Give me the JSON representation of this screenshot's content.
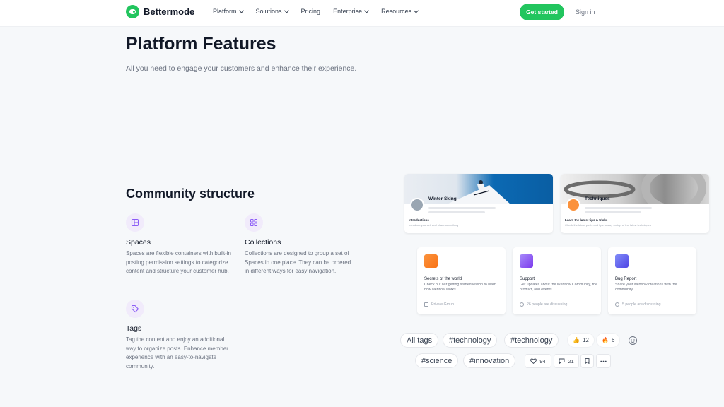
{
  "brand": {
    "name": "Bettermode",
    "accent": "#22c55e"
  },
  "nav": {
    "links": [
      "Platform",
      "Solutions",
      "Pricing",
      "Enterprise",
      "Resources"
    ],
    "cta": "Get started",
    "signin": "Sign in"
  },
  "hero": {
    "title": "Platform Features",
    "subtitle": "All you need to engage your customers and enhance their experience."
  },
  "community": {
    "title": "Community structure",
    "features": [
      {
        "title": "Spaces",
        "desc": "Spaces are flexible containers with built-in posting permission settings to categorize content and structure your customer hub.",
        "icon": "spaces-icon"
      },
      {
        "title": "Collections",
        "desc": "Collections are designed to group a set of Spaces in one place. They can be ordered in different ways for easy navigation.",
        "icon": "collections-icon"
      },
      {
        "title": "Tags",
        "desc": "Tag the content and enjoy an additional way to organize posts. Enhance member experience with an easy-to-navigate community.",
        "icon": "tag-icon"
      }
    ]
  },
  "spaces": [
    {
      "name": "Winter Sking",
      "section": "Introductions",
      "section_desc": "Introduce yourself and share something"
    },
    {
      "name": "Techniques",
      "section": "Learn the latest tips & tricks",
      "section_desc": "Check the latest posts and tips to stay on top of the latest techniques"
    }
  ],
  "collections": [
    {
      "title": "Secrets of the world",
      "desc": "Check out our getting started lesson to learn how webflow works",
      "meta": "Private Group",
      "color": "#f97316"
    },
    {
      "title": "Support",
      "desc": "Get updates about the Webflow Community, the product, and events.",
      "meta": "26 people are discussing",
      "color": "#7c3aed"
    },
    {
      "title": "Bug Report",
      "desc": "Share your webflow creations with the community.",
      "meta": "5 people are discussing",
      "color": "#4f46e5"
    }
  ],
  "tags": {
    "row1": [
      "All tags",
      "#technology",
      "#technology"
    ],
    "row2": [
      "#science",
      "#innovation"
    ]
  },
  "reactions": [
    {
      "emoji": "👍",
      "count": "12"
    },
    {
      "emoji": "🔥",
      "count": "6"
    }
  ],
  "actions": {
    "likes": "94",
    "comments": "21"
  }
}
